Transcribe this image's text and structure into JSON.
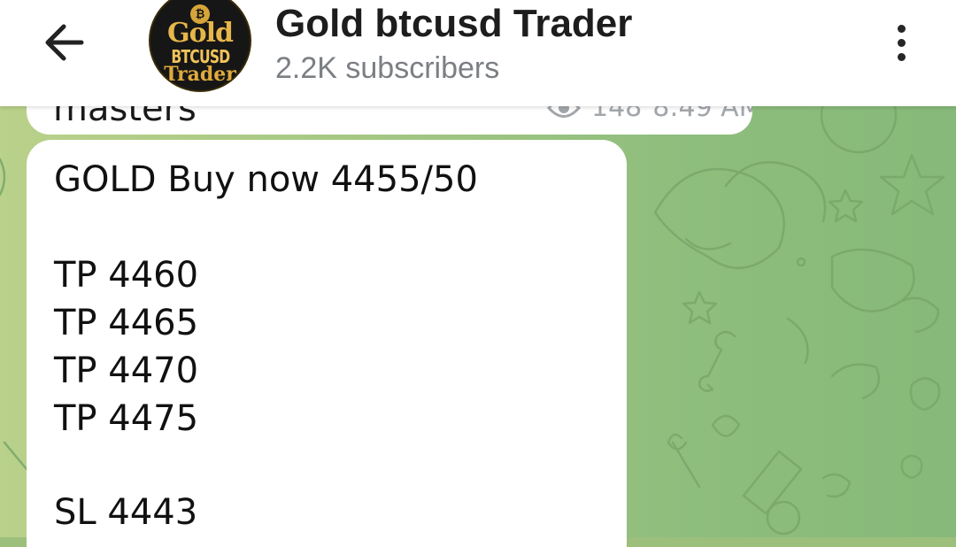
{
  "header": {
    "title": "Gold btcusd Trader",
    "subtitle": "2.2K subscribers",
    "avatar": {
      "line1": "Gold",
      "line2": "BTCUSD",
      "line3": "Trader",
      "coin_symbol": "₿"
    },
    "back_icon": "arrow-left-icon",
    "menu_icon": "more-vertical-icon"
  },
  "previous_message": {
    "text_fragment": "masters",
    "views": "148",
    "time": "8:49 AM",
    "views_icon": "eye-icon"
  },
  "message": {
    "lines": [
      "GOLD Buy now 4455/50",
      "TP 4460",
      "TP 4465",
      "TP 4470",
      "TP 4475",
      "SL 4443"
    ]
  },
  "colors": {
    "header_bg": "#ffffff",
    "chat_bg": "#9cbf7c",
    "bubble_bg": "#ffffff",
    "meta_text": "#a3a7ab",
    "title_text": "#1d1d1d",
    "subtitle_text": "#7b7f84"
  }
}
